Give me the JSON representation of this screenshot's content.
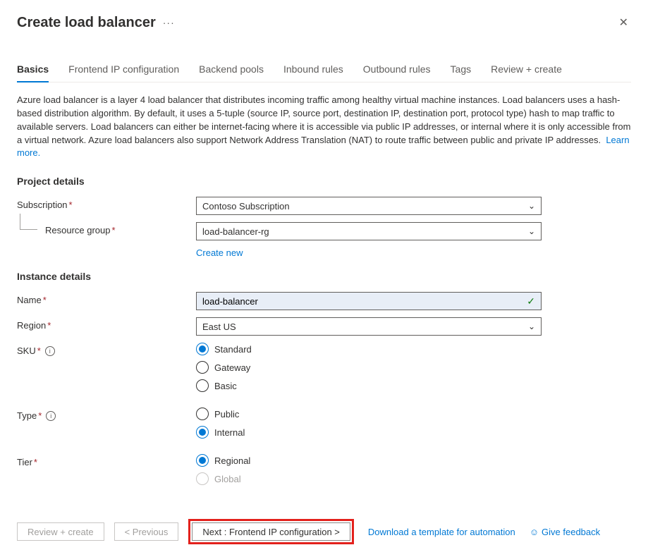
{
  "header": {
    "title": "Create load balancer"
  },
  "tabs": {
    "items": [
      {
        "label": "Basics",
        "active": true
      },
      {
        "label": "Frontend IP configuration"
      },
      {
        "label": "Backend pools"
      },
      {
        "label": "Inbound rules"
      },
      {
        "label": "Outbound rules"
      },
      {
        "label": "Tags"
      },
      {
        "label": "Review + create"
      }
    ]
  },
  "description": {
    "text": "Azure load balancer is a layer 4 load balancer that distributes incoming traffic among healthy virtual machine instances. Load balancers uses a hash-based distribution algorithm. By default, it uses a 5-tuple (source IP, source port, destination IP, destination port, protocol type) hash to map traffic to available servers. Load balancers can either be internet-facing where it is accessible via public IP addresses, or internal where it is only accessible from a virtual network. Azure load balancers also support Network Address Translation (NAT) to route traffic between public and private IP addresses.",
    "learn_more": "Learn more."
  },
  "project": {
    "section_title": "Project details",
    "subscription_label": "Subscription",
    "subscription_value": "Contoso Subscription",
    "rg_label": "Resource group",
    "rg_value": "load-balancer-rg",
    "create_new": "Create new"
  },
  "instance": {
    "section_title": "Instance details",
    "name_label": "Name",
    "name_value": "load-balancer",
    "region_label": "Region",
    "region_value": "East US",
    "sku_label": "SKU",
    "sku_options": [
      "Standard",
      "Gateway",
      "Basic"
    ],
    "sku_selected": "Standard",
    "type_label": "Type",
    "type_options": [
      "Public",
      "Internal"
    ],
    "type_selected": "Internal",
    "tier_label": "Tier",
    "tier_options": [
      "Regional",
      "Global"
    ],
    "tier_selected": "Regional",
    "tier_disabled": "Global"
  },
  "footer": {
    "review": "Review + create",
    "prev": "< Previous",
    "next": "Next : Frontend IP configuration >",
    "download_template": "Download a template for automation",
    "feedback": "Give feedback"
  }
}
